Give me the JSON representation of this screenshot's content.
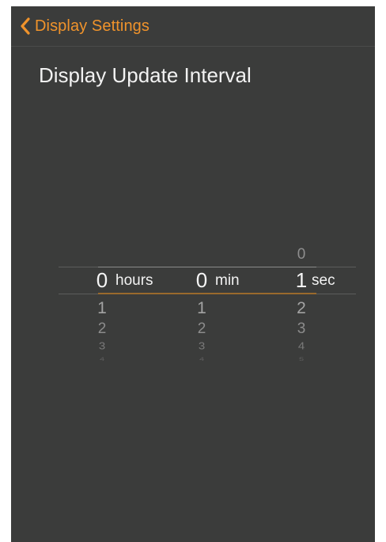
{
  "nav": {
    "back_label": "Display Settings"
  },
  "page": {
    "title": "Display Update Interval"
  },
  "picker": {
    "hours": {
      "unit": "hours",
      "selected": "0",
      "above": [],
      "below": [
        "1",
        "2",
        "3",
        "4"
      ]
    },
    "minutes": {
      "unit": "min",
      "selected": "0",
      "above": [],
      "below": [
        "1",
        "2",
        "3",
        "4"
      ]
    },
    "seconds": {
      "unit": "sec",
      "selected": "1",
      "above": [
        "0"
      ],
      "below": [
        "2",
        "3",
        "4",
        "5"
      ]
    }
  },
  "colors": {
    "accent": "#f0932b",
    "background": "#3b3c3b",
    "text_primary": "#f2f2f2",
    "text_secondary": "#9a9a9a"
  },
  "icons": {
    "back": "chevron-left-icon"
  }
}
